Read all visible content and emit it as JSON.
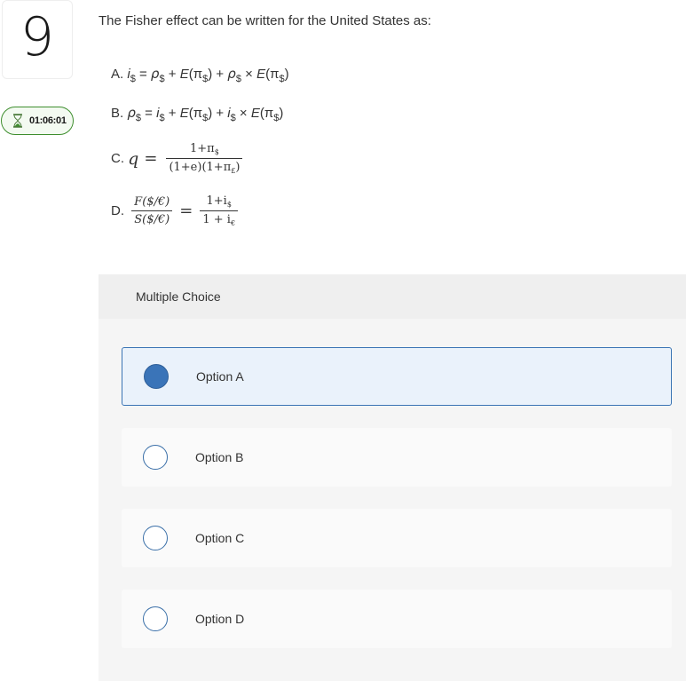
{
  "question": {
    "number": "9",
    "timer": "01:06:01",
    "prompt": "The Fisher effect can be written for the United States as:",
    "options_text": {
      "A": {
        "prefix": "A. ",
        "lhs": "i",
        "lhs_sub": "$",
        "eq": " = ",
        "t1": "ρ",
        "t1_sub": "$",
        "plus1": " + ",
        "t2": "E",
        "t2_paren_open": "(π",
        "t2_sub": "$",
        "t2_paren_close": ")",
        "plus2": " + ",
        "t3": "ρ",
        "t3_sub": "$",
        "times": " × ",
        "t4": "E",
        "t4_paren_open": "(π",
        "t4_sub": "$",
        "t4_paren_close": ")"
      },
      "B": {
        "prefix": "B. ",
        "lhs": "ρ",
        "lhs_sub": "$",
        "eq": " = ",
        "t1": "i",
        "t1_sub": "$",
        "plus1": " + ",
        "t2": "E",
        "t2_paren_open": "(π",
        "t2_sub": "$",
        "t2_paren_close": ")",
        "plus2": " + ",
        "t3": "i",
        "t3_sub": "$",
        "times": " × ",
        "t4": "E",
        "t4_paren_open": "(π",
        "t4_sub": "$",
        "t4_paren_close": ")"
      },
      "C": {
        "prefix": "C. ",
        "lhs": "q",
        "eq": "=",
        "num": "1+π",
        "num_sub": "$",
        "den_a": "(1+e)",
        "den_b": "(1+π",
        "den_b_sub": "£",
        "den_b_close": ")"
      },
      "D": {
        "prefix": "D. ",
        "num_l": "F($/€)",
        "den_l": "S($/€)",
        "eq": "=",
        "num_r": "1+i",
        "num_r_sub": "$",
        "den_r": "1 + i",
        "den_r_sub": "€"
      }
    }
  },
  "answer_panel": {
    "header": "Multiple Choice",
    "choices": [
      {
        "label": "Option A",
        "selected": true
      },
      {
        "label": "Option B",
        "selected": false
      },
      {
        "label": "Option C",
        "selected": false
      },
      {
        "label": "Option D",
        "selected": false
      }
    ]
  },
  "colors": {
    "accent": "#3a74b8",
    "timer_border": "#3e8e2e",
    "selected_bg": "#eaf2fb"
  }
}
